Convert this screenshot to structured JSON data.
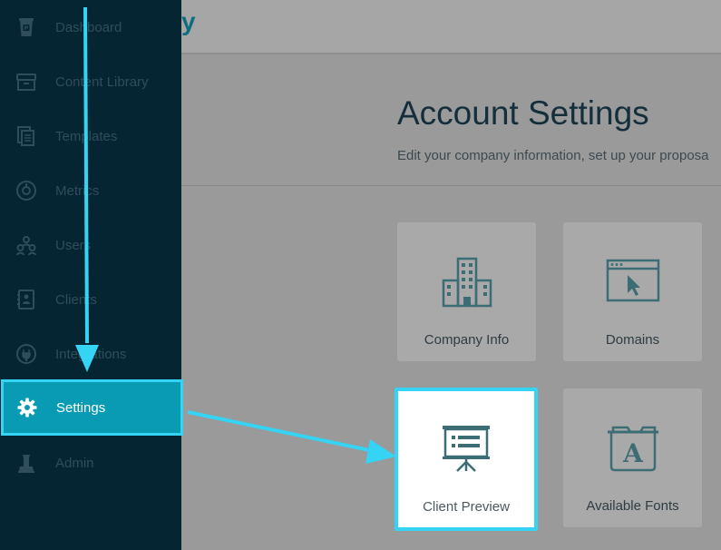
{
  "brand": {
    "fragment": "y"
  },
  "sidebar": {
    "items": [
      {
        "label": "Dashboard",
        "icon": "cup-p-icon"
      },
      {
        "label": "Content Library",
        "icon": "archive-box-icon"
      },
      {
        "label": "Templates",
        "icon": "documents-icon"
      },
      {
        "label": "Metrics",
        "icon": "gauge-icon"
      },
      {
        "label": "Users",
        "icon": "users-icon"
      },
      {
        "label": "Clients",
        "icon": "contact-book-icon"
      },
      {
        "label": "Integrations",
        "icon": "plug-icon"
      },
      {
        "label": "Settings",
        "icon": "gear-icon",
        "active": true
      },
      {
        "label": "Admin",
        "icon": "admin-icon"
      }
    ]
  },
  "main": {
    "title": "Account Settings",
    "subtitle": "Edit your company information, set up your proposa",
    "cards": [
      {
        "label": "Company Info",
        "icon": "building-icon"
      },
      {
        "label": "Domains",
        "icon": "browser-cursor-icon"
      },
      {
        "label": "Client Preview",
        "icon": "presentation-board-icon",
        "highlighted": true
      },
      {
        "label": "Available Fonts",
        "icon": "font-folder-icon"
      }
    ]
  },
  "colors": {
    "sidebar_bg": "#062532",
    "active_bg": "#0a9bb4",
    "highlight": "#35d3f4",
    "icon_teal": "#3d6d74"
  }
}
